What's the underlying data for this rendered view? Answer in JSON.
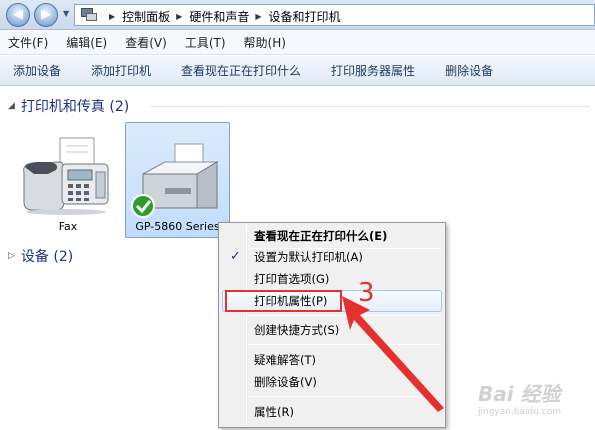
{
  "address": {
    "crumbs": [
      "控制面板",
      "硬件和声音",
      "设备和打印机"
    ]
  },
  "menu": [
    "文件(F)",
    "编辑(E)",
    "查看(V)",
    "工具(T)",
    "帮助(H)"
  ],
  "toolbar": [
    "添加设备",
    "添加打印机",
    "查看现在正在打印什么",
    "打印服务器属性",
    "删除设备"
  ],
  "groups": {
    "printers": "打印机和传真 (2)",
    "devices": "设备 (2)"
  },
  "devices": {
    "fax": "Fax",
    "printer": "GP-5860 Series"
  },
  "context_menu": [
    {
      "label": "查看现在正在打印什么(E)",
      "bold": true
    },
    {
      "label": "设置为默认打印机(A)",
      "checked": true
    },
    {
      "label": "打印首选项(G)"
    },
    {
      "label": "打印机属性(P)",
      "highlighted": true
    },
    {
      "label": "创建快捷方式(S)"
    },
    {
      "label": "疑难解答(T)"
    },
    {
      "label": "删除设备(V)"
    },
    {
      "label": "属性(R)"
    }
  ],
  "annotation": {
    "step": "3",
    "color": "#e4312f"
  },
  "watermark": {
    "text": "Bai 经验",
    "url": "jingyan.baidu.com"
  }
}
